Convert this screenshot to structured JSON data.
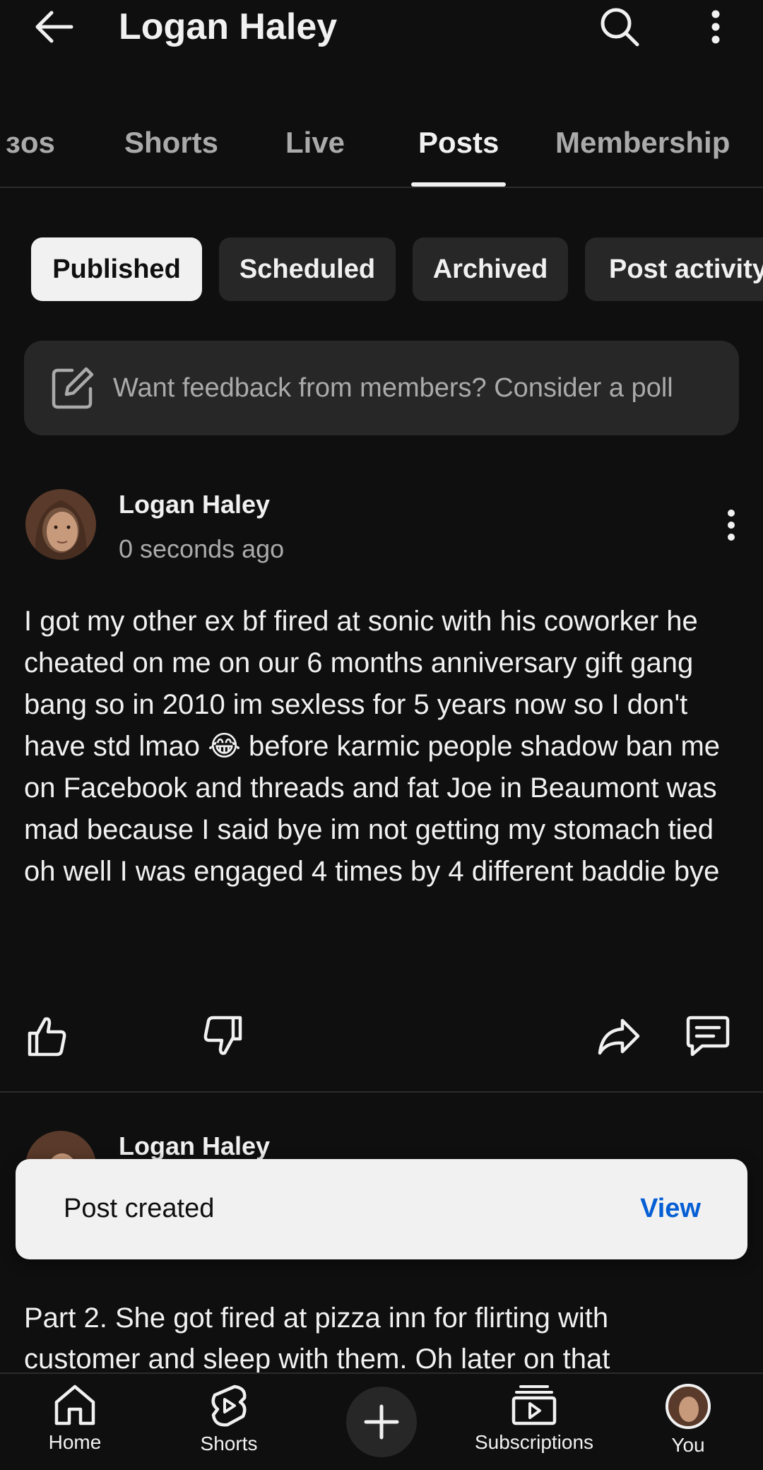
{
  "header": {
    "title": "Logan Haley"
  },
  "tabs": [
    {
      "label": "ɜos"
    },
    {
      "label": "Shorts"
    },
    {
      "label": "Live"
    },
    {
      "label": "Posts"
    },
    {
      "label": "Membership"
    }
  ],
  "filters": [
    {
      "label": "Published"
    },
    {
      "label": "Scheduled"
    },
    {
      "label": "Archived"
    },
    {
      "label": "Post activity"
    }
  ],
  "prompt": {
    "text": "Want feedback from members? Consider a poll"
  },
  "posts": [
    {
      "author": "Logan Haley",
      "time": "0 seconds ago",
      "body": "I got my other ex bf fired at sonic with his coworker he cheated on me on our 6 months anniversary gift gang bang so in 2010 im sexless for 5 years now so I don't have std lmao 😂 before karmic people shadow ban me on Facebook and threads and fat Joe in Beaumont was mad because I said bye im not getting my stomach tied oh well I was engaged 4 times by 4 different baddie bye"
    },
    {
      "author": "Logan Haley",
      "body_preview_1": "Part 2. She got fired at pizza inn for flirting with",
      "body_preview_2": "customer and sleep with them. Oh later on that"
    }
  ],
  "snackbar": {
    "message": "Post created",
    "action": "View"
  },
  "bottom_nav": [
    {
      "label": "Home"
    },
    {
      "label": "Shorts"
    },
    {
      "label": "Subscriptions"
    },
    {
      "label": "You"
    }
  ]
}
